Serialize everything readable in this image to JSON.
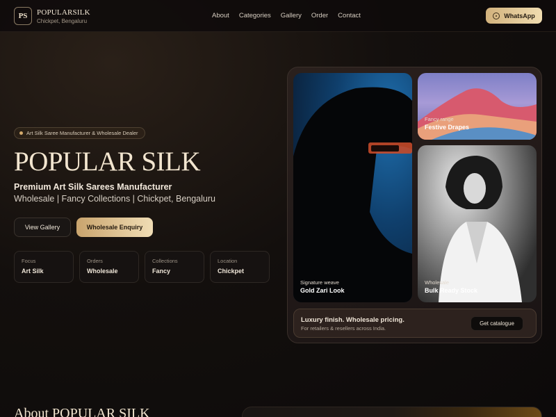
{
  "header": {
    "logo_text": "PS",
    "brand_name": "POPULARSILK",
    "brand_location": "Chickpet, Bengaluru",
    "nav": [
      "About",
      "Categories",
      "Gallery",
      "Order",
      "Contact"
    ],
    "whatsapp_label": "WhatsApp"
  },
  "hero": {
    "badge": "Art Silk Saree Manufacturer & Wholesale Dealer",
    "title": "POPULAR SILK",
    "subtitle": "Premium Art Silk Sarees Manufacturer",
    "tags": "Wholesale | Fancy Collections | Chickpet, Bengaluru",
    "btn_gallery": "View Gallery",
    "btn_enquiry": "Wholesale Enquiry",
    "stats": [
      {
        "label": "Focus",
        "value": "Art Silk"
      },
      {
        "label": "Orders",
        "value": "Wholesale"
      },
      {
        "label": "Collections",
        "value": "Fancy"
      },
      {
        "label": "Location",
        "value": "Chickpet"
      }
    ]
  },
  "gallery": {
    "card1": {
      "small": "Signature weave",
      "big": "Gold Zari Look"
    },
    "card2": {
      "small": "Fancy range",
      "big": "Festive Drapes"
    },
    "card3": {
      "small": "Wholesale",
      "big": "Bulk Ready Stock"
    },
    "strip_title": "Luxury finish. Wholesale pricing.",
    "strip_sub": "For retailers & resellers across India.",
    "btn_catalogue": "Get catalogue"
  },
  "about": {
    "title": "About POPULAR SILK"
  },
  "colors": {
    "accent_gold": "#d2b27d",
    "background": "#0c0a0a"
  }
}
